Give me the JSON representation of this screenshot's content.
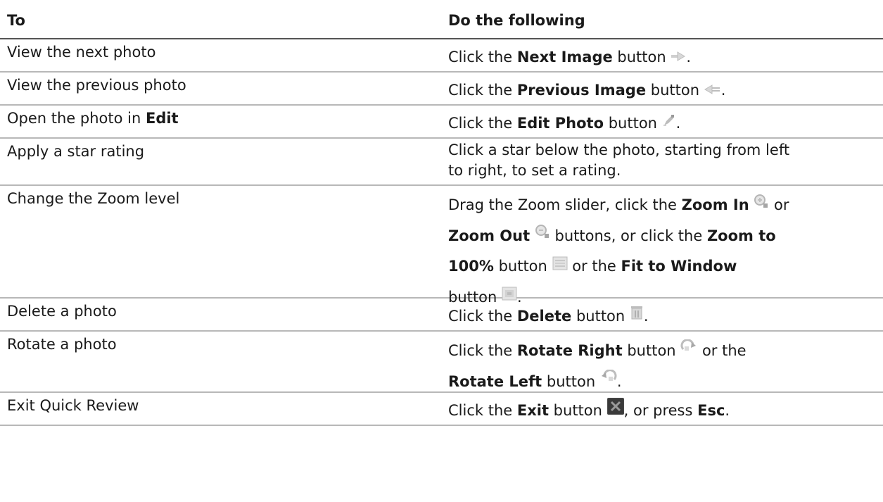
{
  "header": {
    "col_to": "To",
    "col_do": "Do the following"
  },
  "rows": [
    {
      "to": "View the next photo",
      "do": [
        {
          "t": "Click the "
        },
        {
          "b": "Next Image"
        },
        {
          "t": " button "
        },
        {
          "icon": "next-image-icon"
        },
        {
          "t": "."
        }
      ]
    },
    {
      "to": "View the previous photo",
      "do": [
        {
          "t": "Click the "
        },
        {
          "b": "Previous Image"
        },
        {
          "t": " button "
        },
        {
          "icon": "previous-image-icon"
        },
        {
          "t": "."
        }
      ]
    },
    {
      "to_parts": [
        {
          "t": "Open the photo in "
        },
        {
          "b": "Edit"
        }
      ],
      "do": [
        {
          "t": "Click the "
        },
        {
          "b": "Edit Photo"
        },
        {
          "t": " button "
        },
        {
          "icon": "edit-photo-icon"
        },
        {
          "t": "."
        }
      ]
    },
    {
      "to": "Apply a star rating",
      "do_lines": [
        "Click a star below the photo, starting from left",
        "to right, to set a rating."
      ]
    },
    {
      "to": "Change the Zoom level",
      "do_multiline": [
        [
          {
            "t": "Drag the Zoom slider, click the "
          },
          {
            "b": "Zoom In"
          },
          {
            "t": " "
          },
          {
            "icon": "zoom-in-icon"
          },
          {
            "t": " or"
          }
        ],
        [
          {
            "b": "Zoom Out"
          },
          {
            "t": " "
          },
          {
            "icon": "zoom-out-icon"
          },
          {
            "t": " buttons, or click the "
          },
          {
            "b": "Zoom to"
          }
        ],
        [
          {
            "b": "100%"
          },
          {
            "t": " button "
          },
          {
            "icon": "zoom-100-icon"
          },
          {
            "t": " or the "
          },
          {
            "b": "Fit to Window"
          }
        ],
        [
          {
            "t": "button "
          },
          {
            "icon": "fit-window-icon"
          },
          {
            "t": "."
          }
        ]
      ]
    },
    {
      "to": "Delete a photo",
      "do": [
        {
          "t": "Click the "
        },
        {
          "b": "Delete"
        },
        {
          "t": " button "
        },
        {
          "icon": "delete-icon"
        },
        {
          "t": "."
        }
      ]
    },
    {
      "to": "Rotate a photo",
      "do_multiline": [
        [
          {
            "t": "Click the "
          },
          {
            "b": "Rotate Right"
          },
          {
            "t": " button "
          },
          {
            "icon": "rotate-right-icon"
          },
          {
            "t": " or the"
          }
        ],
        [
          {
            "b": "Rotate Left"
          },
          {
            "t": " button "
          },
          {
            "icon": "rotate-left-icon"
          },
          {
            "t": "."
          }
        ]
      ]
    },
    {
      "to": "Exit Quick Review",
      "do": [
        {
          "t": "Click the "
        },
        {
          "b": "Exit"
        },
        {
          "t": " button "
        },
        {
          "icon": "exit-icon"
        },
        {
          "t": ", or press "
        },
        {
          "b": "Esc"
        },
        {
          "t": "."
        }
      ]
    }
  ]
}
